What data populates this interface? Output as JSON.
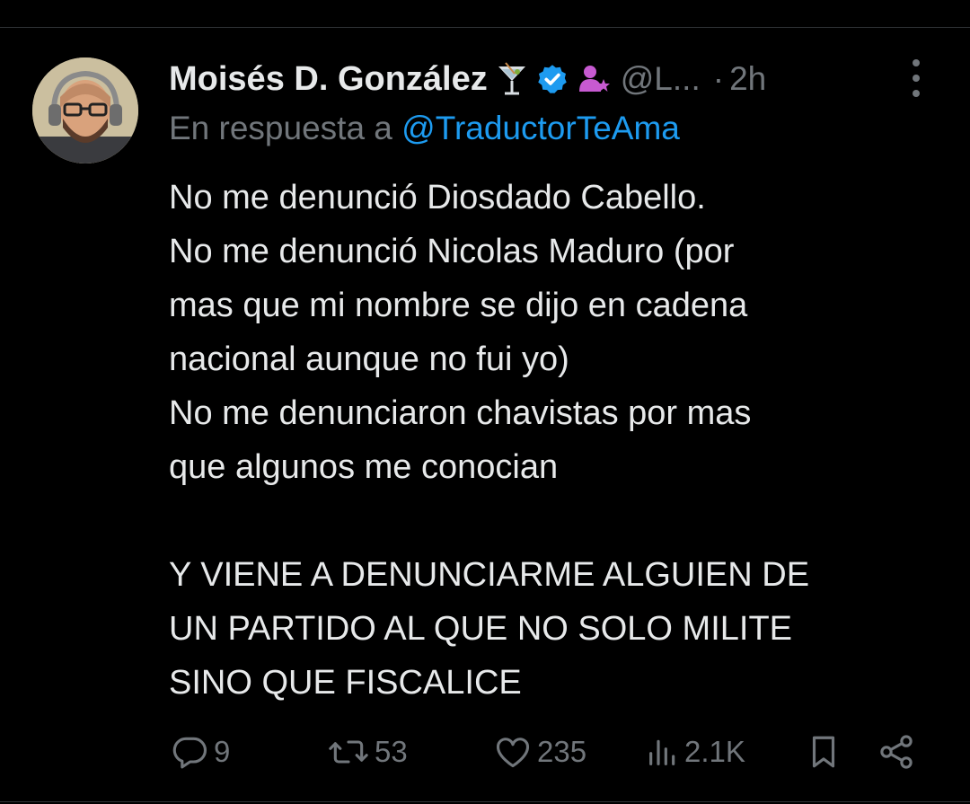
{
  "tweet": {
    "author_name": "Moisés D. González",
    "handle": "@L...",
    "separator": "·",
    "time": "2h",
    "reply_prefix": "En respuesta a",
    "reply_to": "@TraductorTeAma",
    "body_lines": [
      "No me denunció Diosdado Cabello.",
      "No me denunció Nicolas Maduro (por",
      "mas que mi nombre se dijo en cadena",
      "nacional aunque no fui yo)",
      "No me denunciaron chavistas por mas",
      "que algunos me conocian",
      "Y VIENE A DENUNCIARME ALGUIEN DE",
      "UN PARTIDO AL QUE NO SOLO MILITE",
      "SINO QUE FISCALICE"
    ]
  },
  "actions": {
    "replies": "9",
    "retweets": "53",
    "likes": "235",
    "views": "2.1K"
  },
  "icons": [
    "cocktail-icon",
    "verified-badge-icon",
    "affiliate-person-icon",
    "more-icon",
    "reply-icon",
    "retweet-icon",
    "like-icon",
    "views-icon",
    "bookmark-icon",
    "share-icon"
  ],
  "colors": {
    "background": "#000000",
    "text": "#e7e9ea",
    "muted": "#71767b",
    "link": "#1d9bf0",
    "verified": "#1d9bf0",
    "affiliate": "#c75ad1"
  }
}
